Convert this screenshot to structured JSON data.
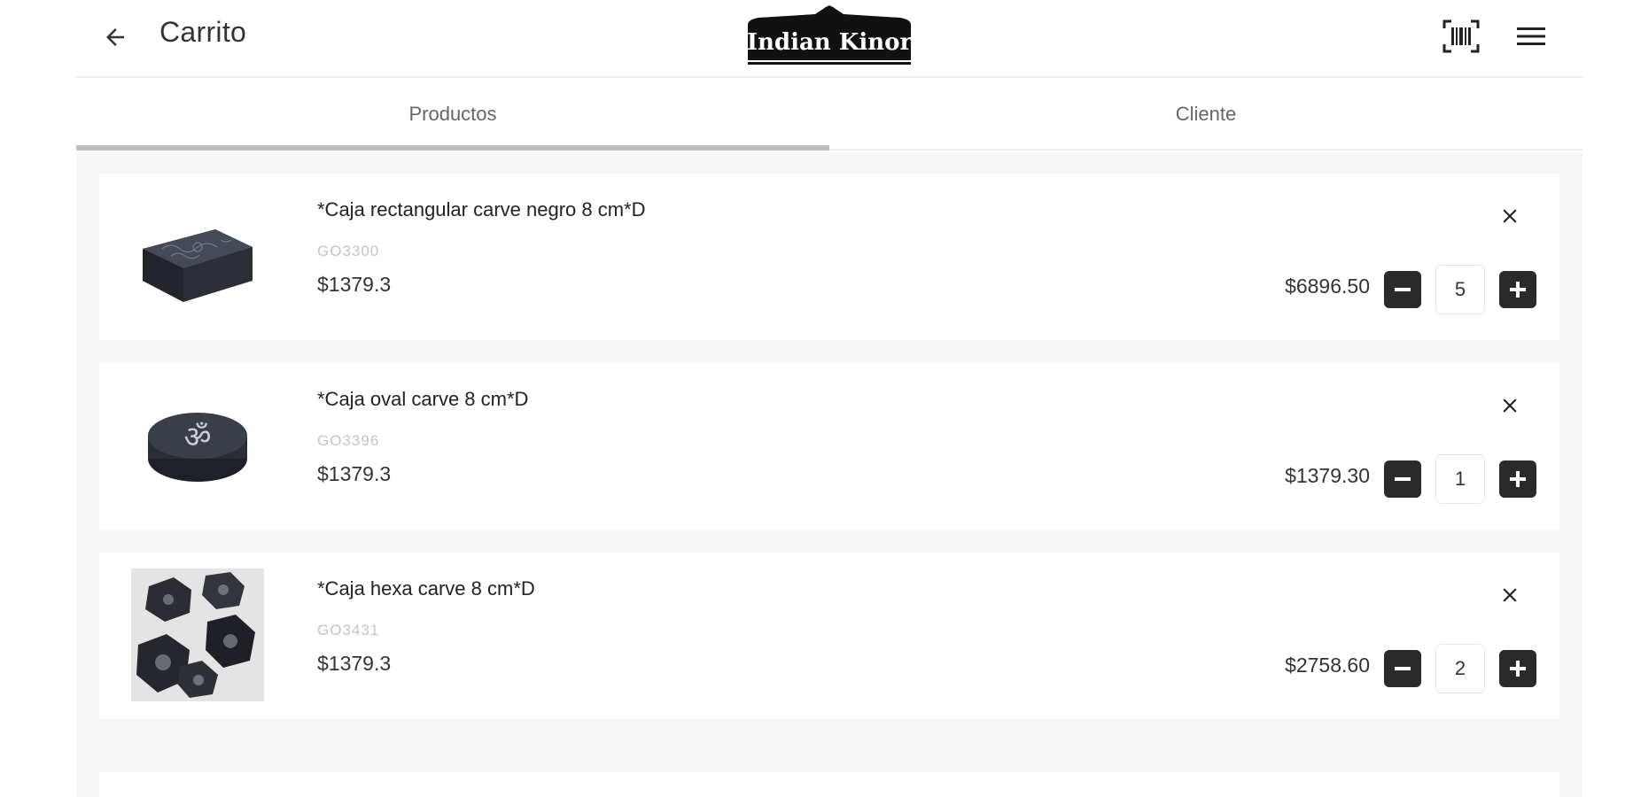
{
  "header": {
    "title": "Carrito",
    "logo_text": "Indian Kinor",
    "icons": {
      "back": "arrow-left-icon",
      "scan": "barcode-scan-icon",
      "menu": "hamburger-menu-icon"
    }
  },
  "tabs": [
    {
      "label": "Productos",
      "active": true
    },
    {
      "label": "Cliente",
      "active": false
    }
  ],
  "cart": {
    "items": [
      {
        "name": "*Caja rectangular carve negro 8 cm*D",
        "sku": "GO3300",
        "price": "$1379.3",
        "total": "$6896.50",
        "quantity": "5",
        "image": "rectangular-black-box"
      },
      {
        "name": "*Caja oval carve 8 cm*D",
        "sku": "GO3396",
        "price": "$1379.3",
        "total": "$1379.30",
        "quantity": "1",
        "image": "oval-black-box-om"
      },
      {
        "name": "*Caja hexa carve 8 cm*D",
        "sku": "GO3431",
        "price": "$1379.3",
        "total": "$2758.60",
        "quantity": "2",
        "image": "hexagonal-carved-boxes"
      }
    ]
  },
  "colors": {
    "accent_dark": "#2a2a2a",
    "tab_indicator": "#bdbdbd",
    "background_content": "#f7f7f7"
  }
}
